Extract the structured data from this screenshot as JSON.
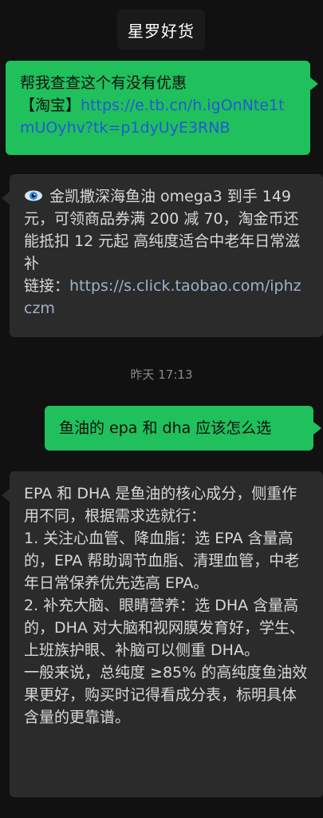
{
  "header": {
    "title": "星罗好货"
  },
  "messages": {
    "m1": {
      "text": "帮我查查这个有没有优惠",
      "prefix": "【淘宝】",
      "link": "https://e.tb.cn/h.igOnNte1tmUOyhv?tk=p1dyUyE3RNB"
    },
    "m2": {
      "icon": "eye-icon",
      "text": "金凯撒深海鱼油 omega3 到手 149元，可领商品券满 200 减 70，淘金币还能抵扣 12 元起 高纯度适合中老年日常滋补",
      "link_label": "链接：",
      "link": "https://s.click.taobao.com/iphzczm"
    },
    "timestamp": "昨天 17:13",
    "m3": {
      "text": "鱼油的 epa 和 dha 应该怎么选"
    },
    "m4": {
      "text": "EPA 和 DHA 是鱼油的核心成分，侧重作用不同，根据需求选就行：\n1. 关注心血管、降血脂：选 EPA 含量高的，EPA 帮助调节血脂、清理血管，中老年日常保养优先选高 EPA。\n2. 补充大脑、眼睛营养：选 DHA 含量高的，DHA 对大脑和视网膜发育好，学生、上班族护眼、补脑可以侧重 DHA。\n一般来说，总纯度 ≥85% 的高纯度鱼油效果更好，购买时记得看成分表，标明具体含量的更靠谱。"
    }
  },
  "colors": {
    "background": "#111111",
    "outgoing_bubble": "#20c05c",
    "incoming_bubble": "#2b2b2b",
    "outgoing_link": "#215ad3",
    "incoming_link": "#9fb1c7"
  }
}
